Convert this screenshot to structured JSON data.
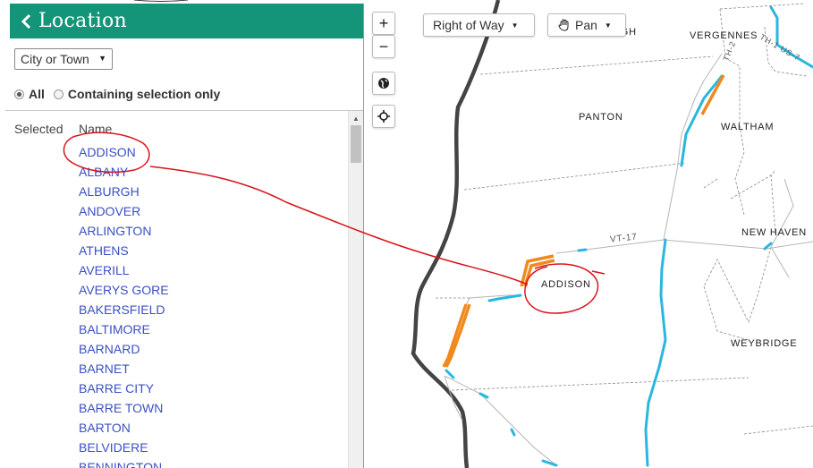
{
  "panel": {
    "title": "Location",
    "location_type_select": "City or Town",
    "radio_all_label": "All",
    "radio_selection_label": "Containing selection only",
    "col_selected": "Selected",
    "col_name": "Name",
    "towns": [
      "ADDISON",
      "ALBANY",
      "ALBURGH",
      "ANDOVER",
      "ARLINGTON",
      "ATHENS",
      "AVERILL",
      "AVERYS GORE",
      "BAKERSFIELD",
      "BALTIMORE",
      "BARNARD",
      "BARNET",
      "BARRE CITY",
      "BARRE TOWN",
      "BARTON",
      "BELVIDERE",
      "BENNINGTON"
    ]
  },
  "map": {
    "zoom_in": "+",
    "zoom_out": "−",
    "layer_dropdown": "Right of Way",
    "tool_dropdown": "Pan",
    "places": {
      "ferrisburgh": "RGH",
      "vergennes": "VERGENNES",
      "panton": "PANTON",
      "waltham": "WALTHAM",
      "new_haven": "NEW HAVEN",
      "addison": "ADDISON",
      "weybridge": "WEYBRIDGE"
    },
    "roads": {
      "vt17": "VT-17",
      "th2": "TH-2",
      "th1_us7": "TH-1 US-7"
    }
  },
  "colors": {
    "header": "#14957a",
    "link": "#3b4fc4",
    "row_segment": "#f08a1e",
    "road_highlight": "#29b6df",
    "lake_shore": "#444444",
    "annotation": "#d9141b"
  }
}
